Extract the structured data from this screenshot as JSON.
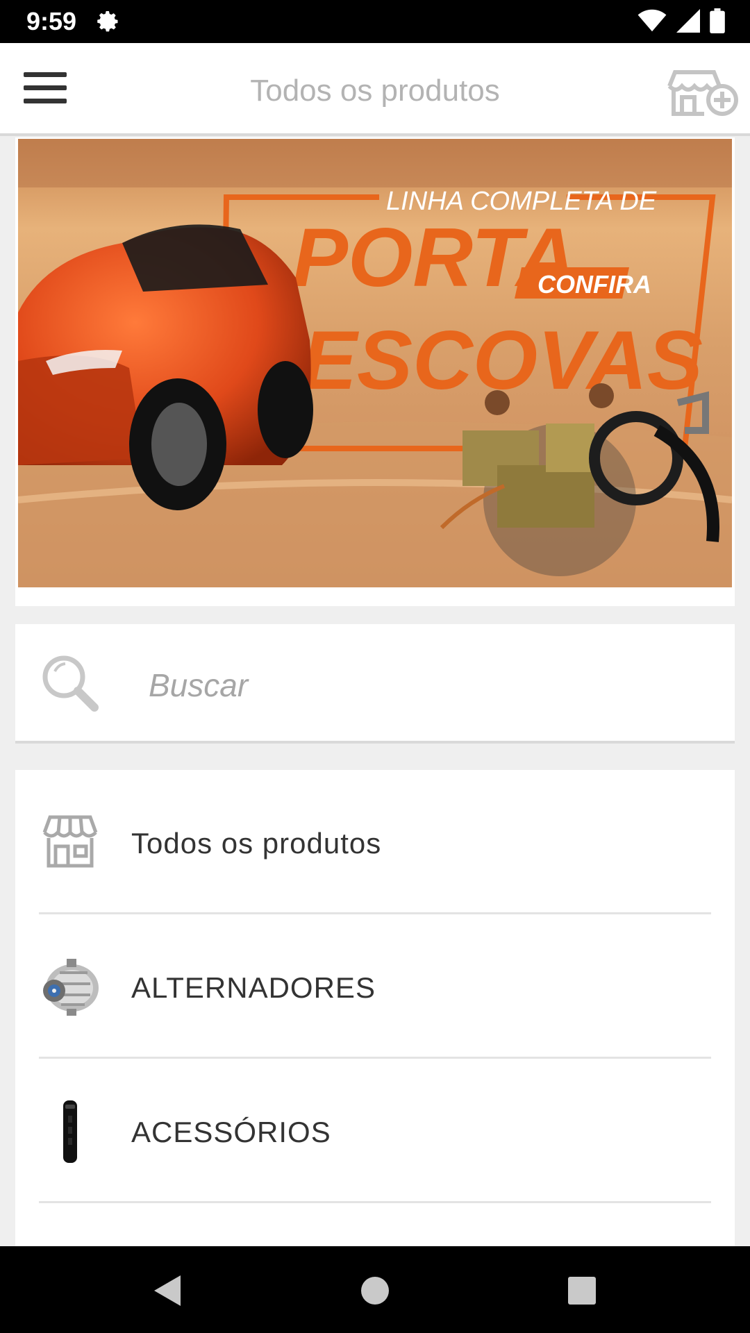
{
  "status_bar": {
    "time": "9:59",
    "icons": [
      "gear-icon",
      "wifi-icon",
      "signal-icon",
      "battery-icon"
    ]
  },
  "header": {
    "title": "Todos os produtos",
    "menu_icon": "hamburger-menu-icon",
    "action_icon": "store-add-icon"
  },
  "banner": {
    "line1": "LINHA COMPLETA DE",
    "line2": "PORTA",
    "line3": "ESCOVAS",
    "cta": "CONFIRA",
    "accent": "#e8661c"
  },
  "search": {
    "placeholder": "Buscar",
    "value": ""
  },
  "categories": [
    {
      "label": "Todos os produtos",
      "icon": "store-icon"
    },
    {
      "label": "ALTERNADORES",
      "icon": "alternator-icon"
    },
    {
      "label": "ACESSÓRIOS",
      "icon": "remote-control-icon"
    }
  ],
  "nav_bar": {
    "buttons": [
      "back-icon",
      "home-icon",
      "recents-icon"
    ]
  }
}
